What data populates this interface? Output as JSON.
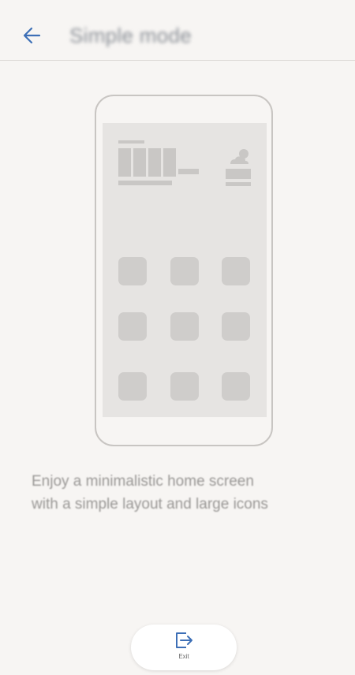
{
  "header": {
    "title": "Simple mode",
    "back_icon": "arrow-left-icon",
    "accent_color": "#3d6fb6"
  },
  "illustration": {
    "weather_icon": "sun-cloud-icon",
    "grid_rows": 3,
    "grid_cols": 3
  },
  "description": {
    "line1": "Enjoy a minimalistic home screen",
    "line2": "with a simple layout and large icons"
  },
  "exit_button": {
    "label": "Exit",
    "icon": "exit-icon"
  }
}
